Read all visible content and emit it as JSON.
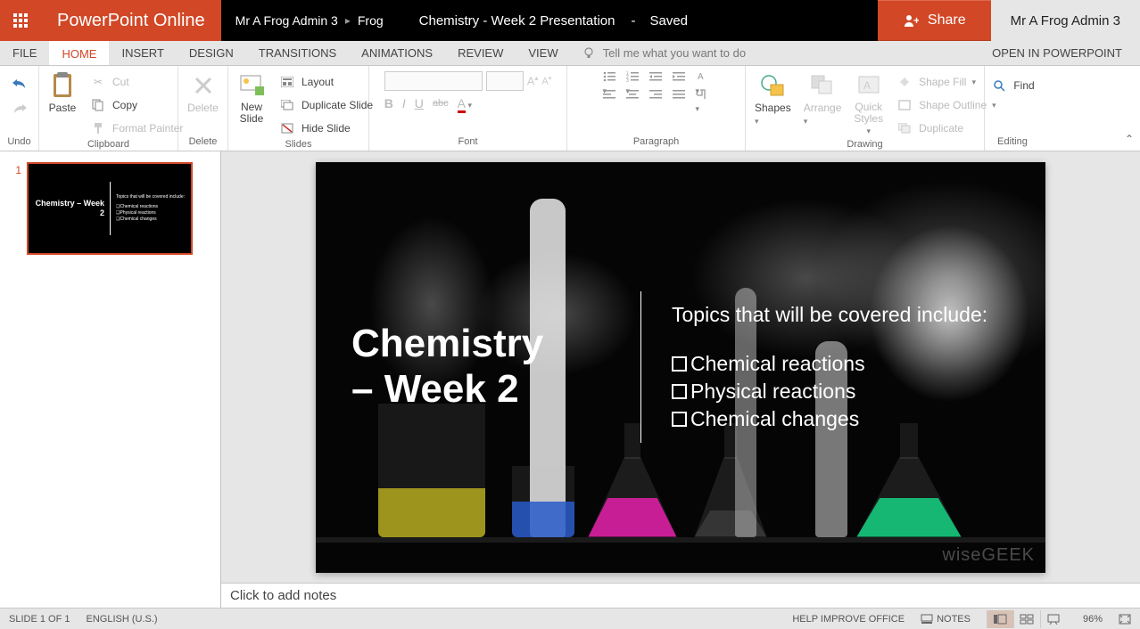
{
  "titlebar": {
    "app_name": "PowerPoint Online",
    "breadcrumb_part1": "Mr A Frog Admin 3",
    "breadcrumb_part2": "Frog",
    "document_title": "Chemistry - Week 2 Presentation",
    "saved_dash": "-",
    "saved_status": "Saved",
    "share_label": "Share",
    "user_name": "Mr A Frog Admin 3"
  },
  "tabs": {
    "file": "FILE",
    "home": "HOME",
    "insert": "INSERT",
    "design": "DESIGN",
    "transitions": "TRANSITIONS",
    "animations": "ANIMATIONS",
    "review": "REVIEW",
    "view": "VIEW",
    "tellme": "Tell me what you want to do",
    "open_in": "OPEN IN POWERPOINT"
  },
  "ribbon": {
    "undo": {
      "label": "Undo"
    },
    "clipboard": {
      "paste": "Paste",
      "cut": "Cut",
      "copy": "Copy",
      "format_painter": "Format Painter",
      "group_label": "Clipboard"
    },
    "delete": {
      "btn": "Delete",
      "group_label": "Delete"
    },
    "slides": {
      "new_slide": "New Slide",
      "layout": "Layout",
      "duplicate_slide": "Duplicate Slide",
      "hide_slide": "Hide Slide",
      "group_label": "Slides"
    },
    "font": {
      "group_label": "Font"
    },
    "paragraph": {
      "group_label": "Paragraph"
    },
    "drawing": {
      "shapes": "Shapes",
      "arrange": "Arrange",
      "quick_styles": "Quick Styles",
      "shape_fill": "Shape Fill",
      "shape_outline": "Shape Outline",
      "duplicate": "Duplicate",
      "group_label": "Drawing"
    },
    "editing": {
      "find": "Find",
      "group_label": "Editing"
    }
  },
  "thumb": {
    "number": "1",
    "title": "Chemistry – Week 2",
    "topics_head": "Topics that will be covered include:",
    "b1": "Chemical reactions",
    "b2": "Physical reactions",
    "b3": "Chemical changes"
  },
  "slide": {
    "title_line1": "Chemistry",
    "title_line2": "– Week 2",
    "topics_head": "Topics that will be covered include:",
    "bullet1": "Chemical reactions",
    "bullet2": "Physical reactions",
    "bullet3": "Chemical changes",
    "watermark": "wiseGEEK"
  },
  "notes_placeholder": "Click to add notes",
  "statusbar": {
    "slide_count": "SLIDE 1 OF 1",
    "language": "ENGLISH (U.S.)",
    "help": "HELP IMPROVE OFFICE",
    "notes": "NOTES",
    "zoom": "96%"
  }
}
